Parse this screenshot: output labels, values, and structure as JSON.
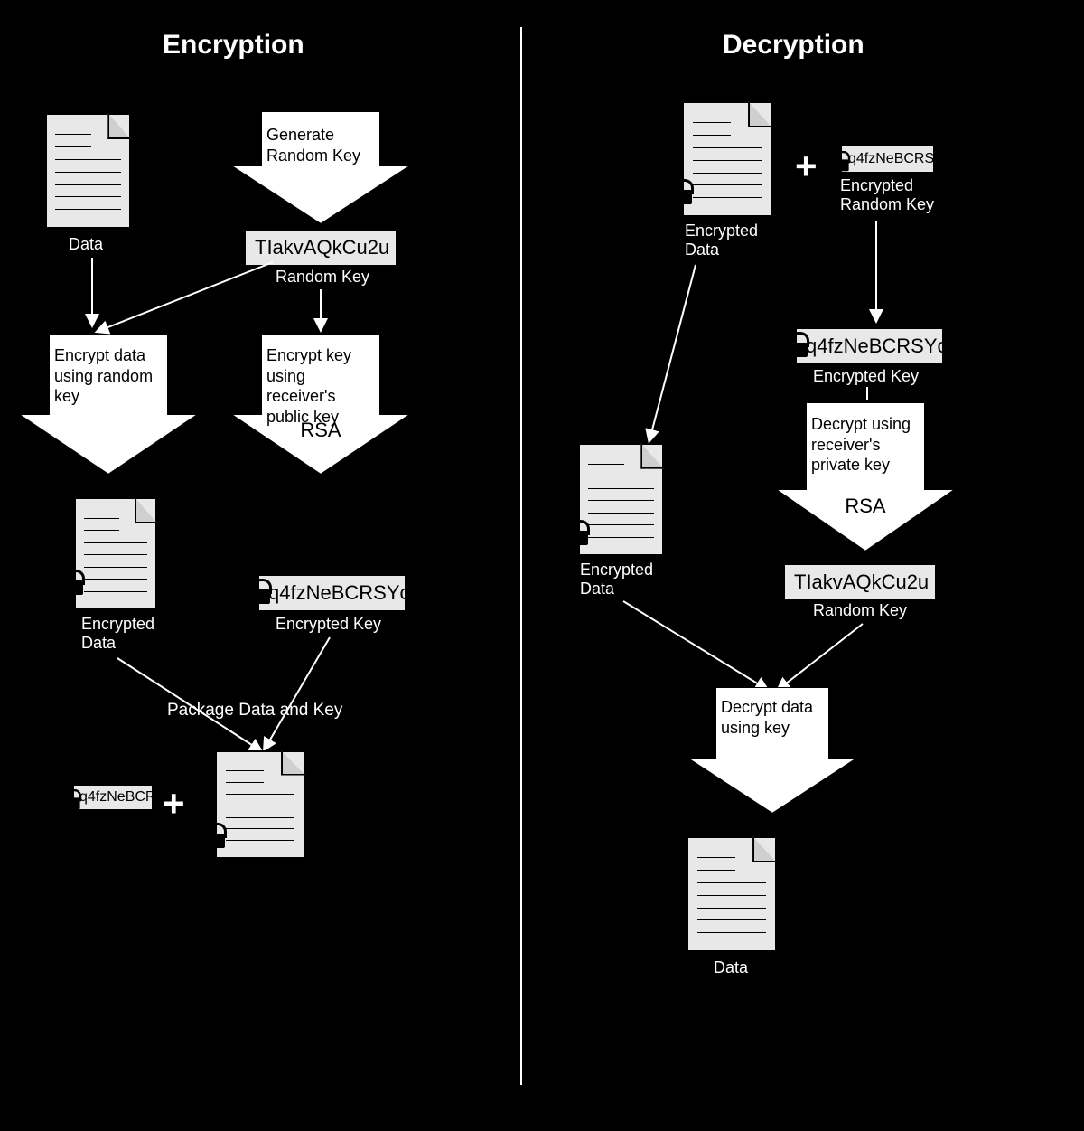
{
  "header_encrypt": "Encryption",
  "header_decrypt": "Decryption",
  "random_key": "TIakvAQkCu2u",
  "encrypted_key": "q4fzNeBCRSYc",
  "arrows": {
    "gen_random": "Generate Random Key",
    "encrypt_data": "Encrypt data using random key",
    "encrypt_key": "Encrypt key using receiver's public key",
    "decrypt_key": "Decrypt using receiver's private key",
    "decrypt_data": "Decrypt data using key",
    "rsa": "RSA"
  },
  "labels": {
    "data": "Data",
    "encrypted_data": "Encrypted\nData",
    "encrypted_key": "Encrypted Key",
    "package": "Package Data and Key",
    "encrypted_random_key": "Encrypted\nRandom Key",
    "random_key": "Random Key"
  }
}
